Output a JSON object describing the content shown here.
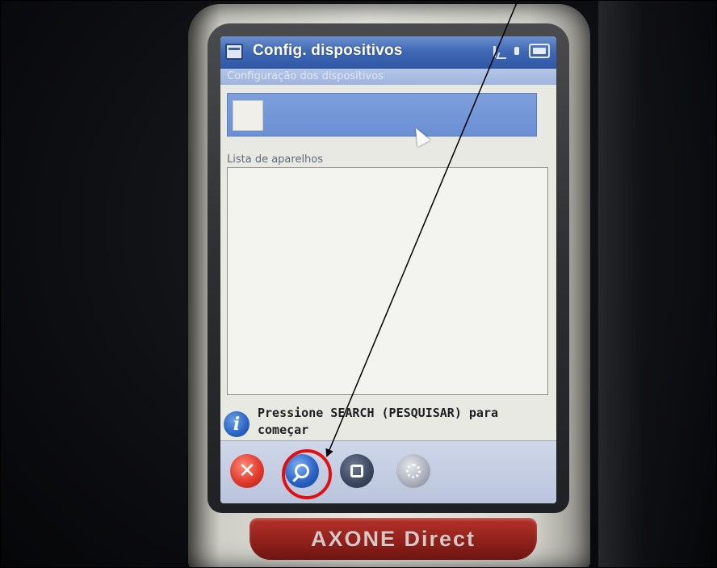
{
  "window": {
    "title": "Config. dispositivos",
    "subheader": "Configuração dos dispositivos"
  },
  "tray": {
    "icons": [
      "signal-icon",
      "volume-icon",
      "battery-icon"
    ]
  },
  "devices_list": {
    "label": "Lista de aparelhos",
    "items": []
  },
  "status": {
    "icon": "info-icon",
    "message": "Pressione SEARCH (PESQUISAR) para começar"
  },
  "toolbar": {
    "buttons": [
      {
        "name": "close-button",
        "icon": "close-icon"
      },
      {
        "name": "search-button",
        "icon": "search-icon"
      },
      {
        "name": "stop-button",
        "icon": "stop-icon"
      },
      {
        "name": "settings-button",
        "icon": "gear-icon"
      }
    ]
  },
  "device_brand": "AXONE Direct",
  "annotation": {
    "color": "#e01010",
    "target": "search-button"
  }
}
